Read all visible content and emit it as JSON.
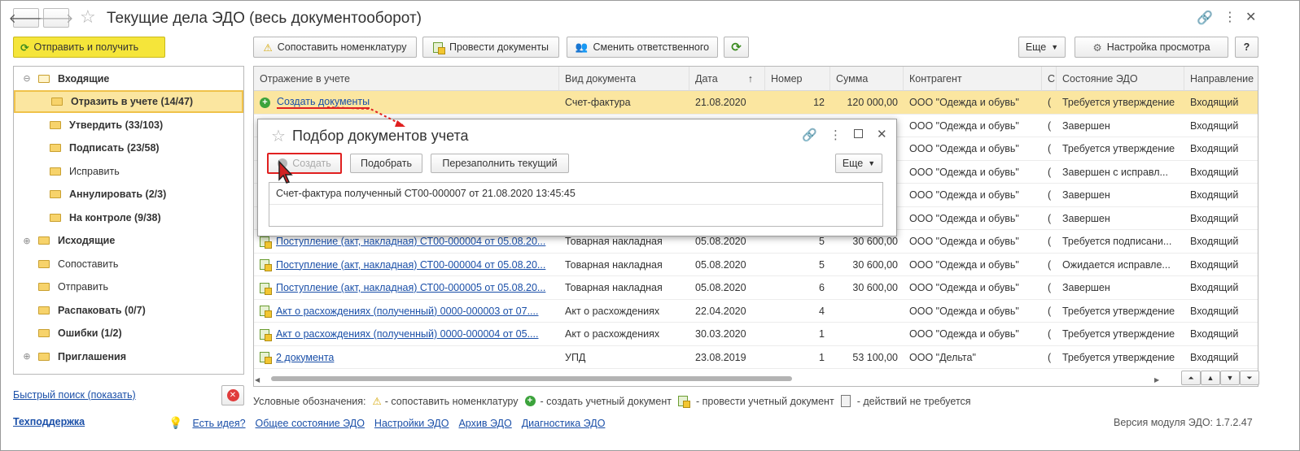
{
  "window": {
    "title": "Текущие дела ЭДО (весь документооборот)"
  },
  "toolbar": {
    "send_receive": "Отправить и получить",
    "match_nomenclature": "Сопоставить номенклатуру",
    "post_documents": "Провести документы",
    "change_responsible": "Сменить ответственного",
    "more": "Еще",
    "view_settings": "Настройка просмотра",
    "help": "?"
  },
  "sidebar": {
    "items": [
      {
        "label": "Входящие",
        "bold": true,
        "level": 0,
        "expander": "⊖",
        "folder": true
      },
      {
        "label": "Отразить в учете (14/47)",
        "bold": true,
        "level": 1,
        "selected": true
      },
      {
        "label": "Утвердить (33/103)",
        "bold": true,
        "level": 1
      },
      {
        "label": "Подписать (23/58)",
        "bold": true,
        "level": 1
      },
      {
        "label": "Исправить",
        "bold": false,
        "level": 1
      },
      {
        "label": "Аннулировать (2/3)",
        "bold": true,
        "level": 1
      },
      {
        "label": "На контроле (9/38)",
        "bold": true,
        "level": 1
      },
      {
        "label": "Исходящие",
        "bold": true,
        "level": 0,
        "expander": "⊕",
        "folder": false
      },
      {
        "label": "Сопоставить",
        "bold": false,
        "level": 0
      },
      {
        "label": "Отправить",
        "bold": false,
        "level": 0
      },
      {
        "label": "Распаковать (0/7)",
        "bold": true,
        "level": 0
      },
      {
        "label": "Ошибки (1/2)",
        "bold": true,
        "level": 0
      },
      {
        "label": "Приглашения",
        "bold": true,
        "level": 0,
        "expander": "⊕",
        "folder": false
      }
    ]
  },
  "quick_search": "Быстрый поиск (показать)",
  "table": {
    "columns": [
      "Отражение в учете",
      "Вид документа",
      "Дата",
      "Номер",
      "Сумма",
      "Контрагент",
      "С",
      "Состояние ЭДО",
      "Направление"
    ],
    "sort_indicator": "↑",
    "rows": [
      {
        "icon": "plus",
        "ref": "Создать документы",
        "type": "Счет-фактура",
        "date": "21.08.2020",
        "num": "12",
        "sum": "120 000,00",
        "contractor": "ООО \"Одежда и обувь\"",
        "c": "(",
        "state": "Требуется утверждение",
        "dir": "Входящий"
      },
      {
        "icon": "doc",
        "ref": "",
        "type": "",
        "date": "",
        "num": "",
        "sum": "",
        "contractor": "ООО \"Одежда и обувь\"",
        "c": "(",
        "state": "Завершен",
        "dir": "Входящий"
      },
      {
        "icon": "doc",
        "ref": "",
        "type": "",
        "date": "",
        "num": "",
        "sum": "",
        "contractor": "ООО \"Одежда и обувь\"",
        "c": "(",
        "state": "Требуется утверждение",
        "dir": "Входящий"
      },
      {
        "icon": "doc",
        "ref": "",
        "type": "",
        "date": "",
        "num": "",
        "sum": "",
        "contractor": "ООО \"Одежда и обувь\"",
        "c": "(",
        "state": "Завершен с исправл...",
        "dir": "Входящий"
      },
      {
        "icon": "doc",
        "ref": "",
        "type": "",
        "date": "",
        "num": "",
        "sum": "",
        "contractor": "ООО \"Одежда и обувь\"",
        "c": "(",
        "state": "Завершен",
        "dir": "Входящий"
      },
      {
        "icon": "doc",
        "ref": "",
        "type": "",
        "date": "",
        "num": "",
        "sum": "",
        "contractor": "ООО \"Одежда и обувь\"",
        "c": "(",
        "state": "Завершен",
        "dir": "Входящий"
      },
      {
        "icon": "doc",
        "ref": "Поступление (акт, накладная) СТ00-000004 от 05.08.20...",
        "type": "Товарная накладная",
        "date": "05.08.2020",
        "num": "5",
        "sum": "30 600,00",
        "contractor": "ООО \"Одежда и обувь\"",
        "c": "(",
        "state": "Требуется подписани...",
        "dir": "Входящий"
      },
      {
        "icon": "doc",
        "ref": "Поступление (акт, накладная) СТ00-000004 от 05.08.20...",
        "type": "Товарная накладная",
        "date": "05.08.2020",
        "num": "5",
        "sum": "30 600,00",
        "contractor": "ООО \"Одежда и обувь\"",
        "c": "(",
        "state": "Ожидается исправле...",
        "dir": "Входящий"
      },
      {
        "icon": "doc",
        "ref": "Поступление (акт, накладная) СТ00-000005 от 05.08.20...",
        "type": "Товарная накладная",
        "date": "05.08.2020",
        "num": "6",
        "sum": "30 600,00",
        "contractor": "ООО \"Одежда и обувь\"",
        "c": "(",
        "state": "Завершен",
        "dir": "Входящий"
      },
      {
        "icon": "doc",
        "ref": "Акт о расхождениях (полученный) 0000-000003 от 07....",
        "type": "Акт о расхождениях",
        "date": "22.04.2020",
        "num": "4",
        "sum": "",
        "contractor": "ООО \"Одежда и обувь\"",
        "c": "(",
        "state": "Требуется утверждение",
        "dir": "Входящий"
      },
      {
        "icon": "doc",
        "ref": "Акт о расхождениях (полученный) 0000-000004 от 05....",
        "type": "Акт о расхождениях",
        "date": "30.03.2020",
        "num": "1",
        "sum": "",
        "contractor": "ООО \"Одежда и обувь\"",
        "c": "(",
        "state": "Требуется утверждение",
        "dir": "Входящий"
      },
      {
        "icon": "doc",
        "ref": "2 документа",
        "type": "УПД",
        "date": "23.08.2019",
        "num": "1",
        "sum": "53 100,00",
        "contractor": "ООО \"Дельта\"",
        "c": "(",
        "state": "Требуется утверждение",
        "dir": "Входящий"
      }
    ]
  },
  "dialog": {
    "title": "Подбор документов учета",
    "create": "Создать",
    "pick": "Подобрать",
    "refill": "Перезаполнить текущий",
    "more": "Еще",
    "list_item": "Счет-фактура полученный СТ00-000007 от 21.08.2020 13:45:45"
  },
  "legend": {
    "caption": "Условные обозначения:",
    "match": "- сопоставить номенклатуру",
    "create": "- создать учетный документ",
    "post": "- провести учетный документ",
    "none": "- действий не требуется"
  },
  "footer": {
    "support": "Техподдержка",
    "links": [
      "Есть идея?",
      "Общее состояние ЭДО",
      "Настройки ЭДО",
      "Архив ЭДО",
      "Диагностика ЭДО"
    ],
    "version": "Версия модуля ЭДО: 1.7.2.47"
  },
  "colors": {
    "accent_yellow": "#f5e53a",
    "selection": "#fbe6a0",
    "link": "#1a4fa8",
    "highlight_red": "#e02020"
  }
}
